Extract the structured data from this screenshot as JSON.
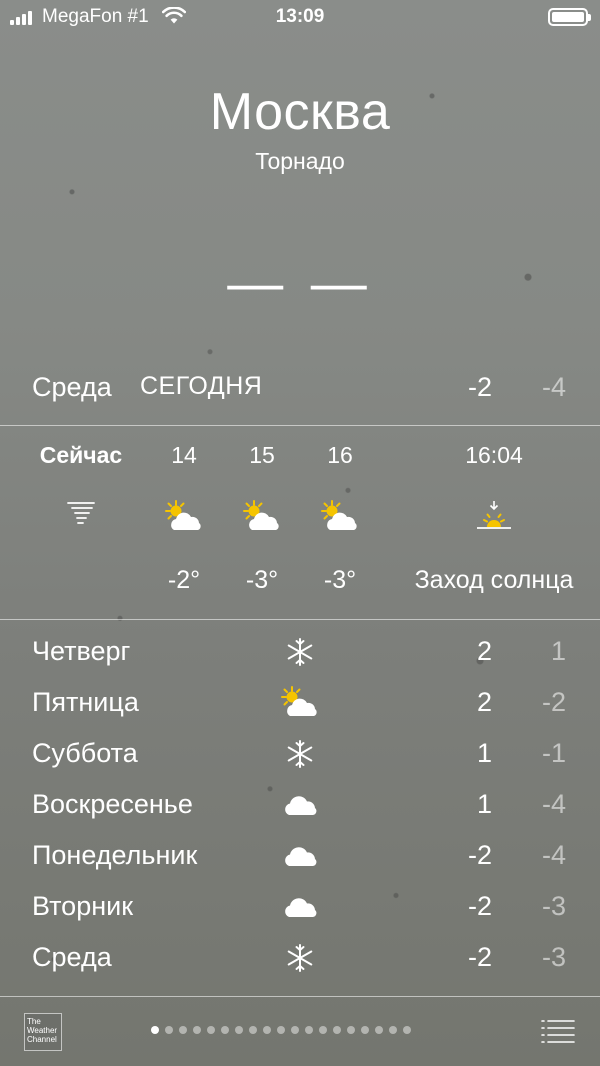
{
  "status_bar": {
    "carrier": "MegaFon #1",
    "time": "13:09"
  },
  "header": {
    "city": "Москва",
    "condition": "Торнадо",
    "current_temp": "— —"
  },
  "today": {
    "day": "Среда",
    "label": "СЕГОДНЯ",
    "high": "-2",
    "low": "-4"
  },
  "hourly": [
    {
      "label": "Сейчас",
      "icon": "tornado-icon",
      "temp": ""
    },
    {
      "label": "14",
      "icon": "partly-cloudy-icon",
      "temp": "-2°"
    },
    {
      "label": "15",
      "icon": "partly-cloudy-icon",
      "temp": "-3°"
    },
    {
      "label": "16",
      "icon": "partly-cloudy-icon",
      "temp": "-3°"
    },
    {
      "label": "16:04",
      "icon": "sunset-icon",
      "temp": "Заход солнца"
    }
  ],
  "daily": [
    {
      "day": "Четверг",
      "icon": "snow-icon",
      "high": "2",
      "low": "1"
    },
    {
      "day": "Пятница",
      "icon": "partly-cloudy-icon",
      "high": "2",
      "low": "-2"
    },
    {
      "day": "Суббота",
      "icon": "snow-icon",
      "high": "1",
      "low": "-1"
    },
    {
      "day": "Воскресенье",
      "icon": "cloud-icon",
      "high": "1",
      "low": "-4"
    },
    {
      "day": "Понедельник",
      "icon": "cloud-icon",
      "high": "-2",
      "low": "-4"
    },
    {
      "day": "Вторник",
      "icon": "cloud-icon",
      "high": "-2",
      "low": "-3"
    },
    {
      "day": "Среда",
      "icon": "snow-icon",
      "high": "-2",
      "low": "-3"
    }
  ],
  "bottom_bar": {
    "logo_lines": [
      "The",
      "Weather",
      "Channel"
    ],
    "page_count": 19,
    "active_page": 0
  }
}
